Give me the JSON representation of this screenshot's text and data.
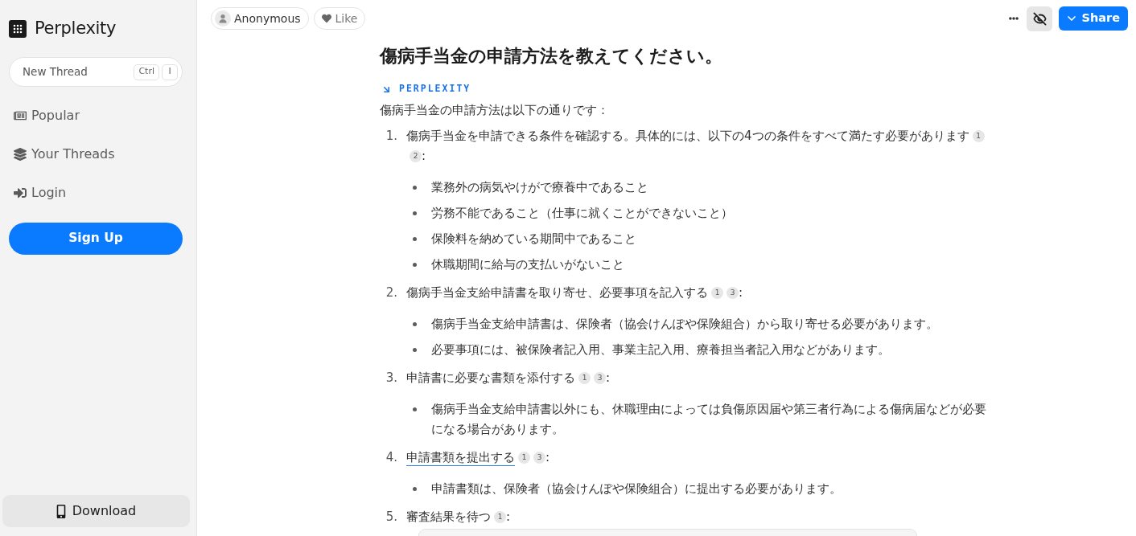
{
  "sidebar": {
    "brand": "Perplexity",
    "new_thread": {
      "label": "New Thread",
      "shortcut": [
        "Ctrl",
        "I"
      ]
    },
    "nav": [
      "Popular",
      "Your Threads",
      "Login"
    ],
    "sign_up": "Sign Up",
    "download": "Download"
  },
  "toolbar": {
    "author": "Anonymous",
    "like": "Like",
    "share": "Share"
  },
  "thread": {
    "question": "傷病手当金の申請方法を教えてください。",
    "source_label": "PERPLEXITY",
    "intro": "傷病手当金の申請方法は以下の通りです：",
    "steps": [
      {
        "number": "1.",
        "text": "傷病手当金を申請できる条件を確認する。具体的には、以下の4つの条件をすべて満たす必要があります",
        "link": false,
        "citations": [
          "1",
          "2"
        ],
        "suffix": ":",
        "bullets": [
          "業務外の病気やけがで療養中であること",
          "労務不能であること（仕事に就くことができないこと）",
          "保険料を納めている期間中であること",
          "休職期間に給与の支払いがないこと"
        ]
      },
      {
        "number": "2.",
        "text": "傷病手当金支給申請書を取り寄せ、必要事項を記入する",
        "link": false,
        "citations": [
          "1",
          "3"
        ],
        "suffix": ":",
        "bullets": [
          "傷病手当金支給申請書は、保険者（協会けんぽや保険組合）から取り寄せる必要があります。",
          "必要事項には、被保険者記入用、事業主記入用、療養担当者記入用などがあります。"
        ]
      },
      {
        "number": "3.",
        "text": "申請書に必要な書類を添付する",
        "link": false,
        "citations": [
          "1",
          "3"
        ],
        "suffix": ":",
        "bullets": [
          "傷病手当金支給申請書以外にも、休職理由によっては負傷原因届や第三者行為による傷病届などが必要になる場合があります。"
        ]
      },
      {
        "number": "4.",
        "text": "申請書類を提出する",
        "link": true,
        "citations": [
          "1",
          "3"
        ],
        "suffix": ":",
        "bullets": [
          "申請書類は、保険者（協会けんぽや保険組合）に提出する必要があります。"
        ]
      },
      {
        "number": "5.",
        "text": "審査結果を待つ",
        "link": false,
        "citations": [
          "1"
        ],
        "suffix": ":"
      }
    ]
  }
}
